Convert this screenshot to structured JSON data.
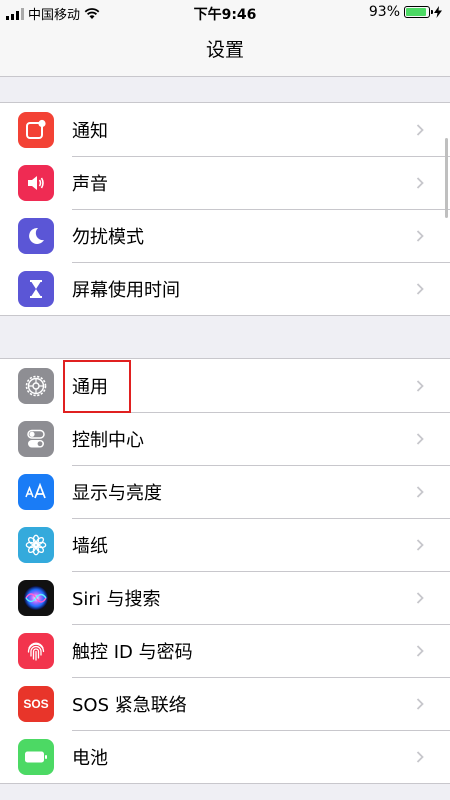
{
  "status_bar": {
    "carrier": "中国移动",
    "time": "下午9:46",
    "battery_percent": "93%",
    "battery_level": 0.93
  },
  "nav": {
    "title": "设置"
  },
  "groups": [
    [
      {
        "label": "通知",
        "icon": "notification-icon",
        "color": "#f34235"
      },
      {
        "label": "声音",
        "icon": "speaker-icon",
        "color": "#ef2b53"
      },
      {
        "label": "勿扰模式",
        "icon": "moon-icon",
        "color": "#5b56d6"
      },
      {
        "label": "屏幕使用时间",
        "icon": "hourglass-icon",
        "color": "#5b56d6"
      }
    ],
    [
      {
        "label": "通用",
        "icon": "gear-icon",
        "color": "#8e8e93"
      },
      {
        "label": "控制中心",
        "icon": "toggle-icon",
        "color": "#8e8e93"
      },
      {
        "label": "显示与亮度",
        "icon": "text-size-icon",
        "color": "#1a7cf6"
      },
      {
        "label": "墙纸",
        "icon": "flower-icon",
        "color": "#34aadc"
      },
      {
        "label": "Siri 与搜索",
        "icon": "siri-icon",
        "color": "#111111"
      },
      {
        "label": "触控 ID 与密码",
        "icon": "fingerprint-icon",
        "color": "#f2344d"
      },
      {
        "label": "SOS 紧急联络",
        "icon": "sos-icon",
        "color": "#e8352a",
        "icon_text": "SOS"
      },
      {
        "label": "电池",
        "icon": "battery-icon",
        "color": "#4cd964"
      }
    ]
  ],
  "highlight_color": "#e02020"
}
